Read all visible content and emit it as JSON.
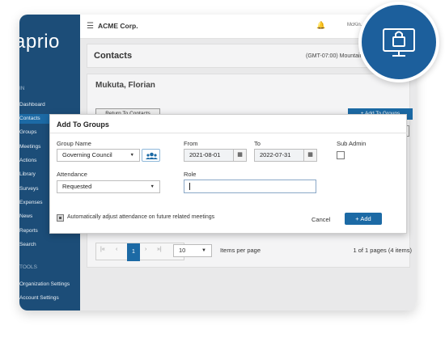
{
  "app": {
    "logo_text": "aprio",
    "company": "ACME Corp.",
    "user": "McKin...",
    "timezone": "(GMT-07:00) Mountain Time"
  },
  "sidebar": {
    "section_top": "IN",
    "items": [
      {
        "label": "Dashboard",
        "active": false
      },
      {
        "label": "Contacts",
        "active": true
      },
      {
        "label": "Groups",
        "active": false
      },
      {
        "label": "Meetings",
        "active": false
      },
      {
        "label": "Actions",
        "active": false
      },
      {
        "label": "Library",
        "active": false
      },
      {
        "label": "Surveys",
        "active": false
      },
      {
        "label": "Expenses",
        "active": false
      },
      {
        "label": "News",
        "active": false
      },
      {
        "label": "Reports",
        "active": false
      },
      {
        "label": "Search",
        "active": false
      }
    ],
    "section_bottom": "TOOLS",
    "bottom_items": [
      {
        "label": "Organization Settings"
      },
      {
        "label": "Account Settings"
      }
    ]
  },
  "page": {
    "title": "Contacts",
    "person": "Mukuta, Florian",
    "return_label": "Return To Contacts",
    "add_groups_label": "+ Add To Groups"
  },
  "pager": {
    "current": "1",
    "per_page": "10",
    "per_page_label": "Items per page",
    "info": "1 of 1 pages (4 items)"
  },
  "modal": {
    "title": "Add To Groups",
    "group_name_label": "Group Name",
    "group_name_value": "Governing Council",
    "from_label": "From",
    "from_value": "2021-08-01",
    "to_label": "To",
    "to_value": "2022-07-31",
    "sub_admin_label": "Sub Admin",
    "attendance_label": "Attendance",
    "attendance_value": "Requested",
    "role_label": "Role",
    "role_value": "",
    "auto_adjust_label": "Automatically adjust attendance on future related meetings",
    "cancel_label": "Cancel",
    "add_label": "+ Add"
  },
  "icons": {
    "menu": "hamburger-icon",
    "bell": "bell-icon",
    "group": "users-icon",
    "calendar": "calendar-icon",
    "search": "search-icon",
    "badge": "monitor-lock-icon"
  },
  "colors": {
    "sidebar": "#1c4d78",
    "accent": "#1c6aa5",
    "badge": "#1c5f9c"
  }
}
